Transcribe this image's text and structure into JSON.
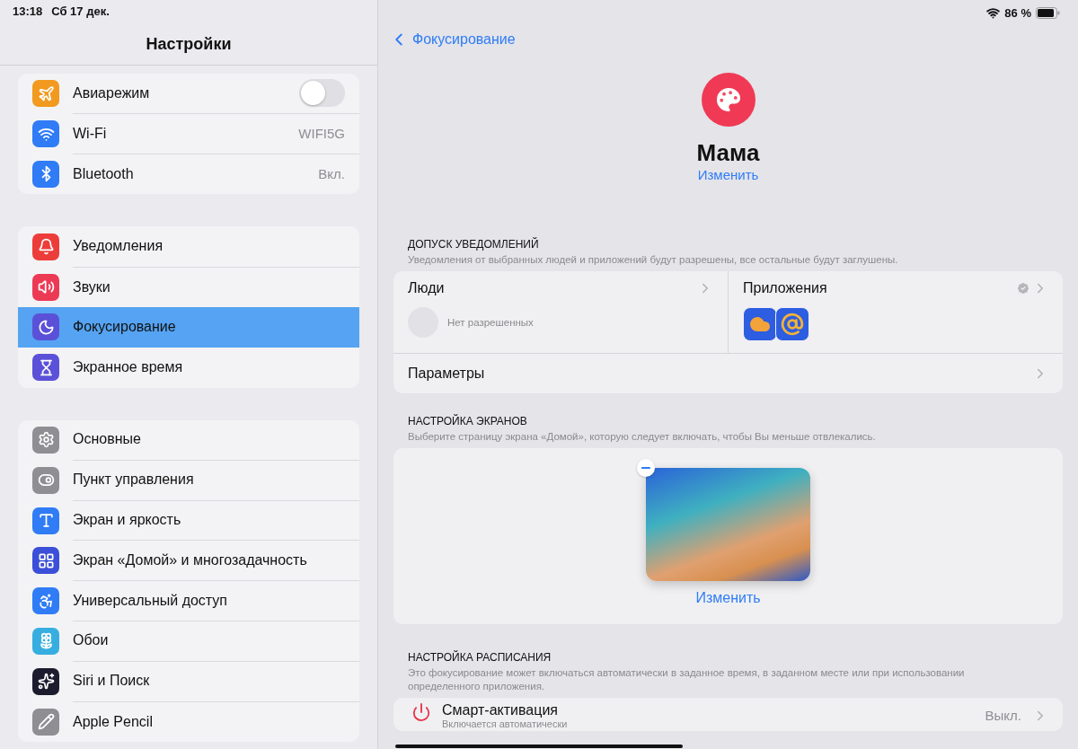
{
  "status_bar": {
    "time": "13:18",
    "date": "Сб 17 дек.",
    "battery": "86 %"
  },
  "sidebar": {
    "title": "Настройки",
    "groups": [
      [
        {
          "label": "Авиарежим",
          "kind": "toggle",
          "on": false,
          "selected": false,
          "color": "#f29a1f"
        },
        {
          "label": "Wi-Fi",
          "kind": "value",
          "value": "WIFI5G",
          "selected": false,
          "color": "#2f7cf6"
        },
        {
          "label": "Bluetooth",
          "kind": "value",
          "value": "Вкл.",
          "selected": false,
          "color": "#2f7cf6"
        }
      ],
      [
        {
          "label": "Уведомления",
          "kind": "link",
          "selected": false,
          "color": "#ec3d3a"
        },
        {
          "label": "Звуки",
          "kind": "link",
          "selected": false,
          "color": "#ec3a55"
        },
        {
          "label": "Фокусирование",
          "kind": "link",
          "selected": true,
          "color": "#5b51d8"
        },
        {
          "label": "Экранное время",
          "kind": "link",
          "selected": false,
          "color": "#5b51d8"
        }
      ],
      [
        {
          "label": "Основные",
          "kind": "link",
          "selected": false,
          "color": "#8e8e93"
        },
        {
          "label": "Пункт управления",
          "kind": "link",
          "selected": false,
          "color": "#8e8e93"
        },
        {
          "label": "Экран и яркость",
          "kind": "link",
          "selected": false,
          "color": "#2f7cf6"
        },
        {
          "label": "Экран «Домой» и многозадачность",
          "kind": "link",
          "selected": false,
          "color": "#3b4fd8"
        },
        {
          "label": "Универсальный доступ",
          "kind": "link",
          "selected": false,
          "color": "#2f7cf6"
        },
        {
          "label": "Обои",
          "kind": "link",
          "selected": false,
          "color": "#38aee0"
        },
        {
          "label": "Siri и Поиск",
          "kind": "link",
          "selected": false,
          "color": "#1c1c2e"
        },
        {
          "label": "Apple Pencil",
          "kind": "link",
          "selected": false,
          "color": "#8e8e93"
        }
      ]
    ]
  },
  "detail": {
    "back": "Фокусирование",
    "focus_name": "Мама",
    "edit": "Изменить",
    "notifications": {
      "header": "ДОПУСК УВЕДОМЛЕНИЙ",
      "description": "Уведомления от выбранных людей и приложений будут разрешены, все остальные будут заглушены.",
      "people": {
        "label": "Люди",
        "empty": "Нет разрешенных"
      },
      "apps": {
        "label": "Приложения"
      },
      "options": {
        "label": "Параметры"
      }
    },
    "screens": {
      "header": "НАСТРОЙКА ЭКРАНОВ",
      "description": "Выберите страницу экрана «Домой», которую следует включать, чтобы Вы меньше отвлекались.",
      "edit": "Изменить"
    },
    "schedule": {
      "header": "НАСТРОЙКА РАСПИСАНИЯ",
      "description": "Это фокусирование может включаться автоматически в заданное время, в заданном месте или при использовании определенного приложения.",
      "rows": [
        {
          "title": "Смарт-активация",
          "subtitle": "Включается автоматически",
          "value": "Выкл."
        }
      ]
    }
  }
}
